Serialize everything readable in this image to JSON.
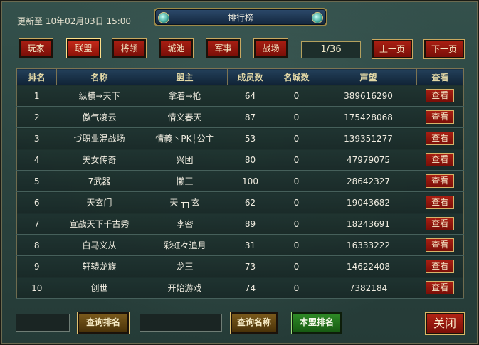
{
  "header": {
    "timestamp": "更新至 10年02月03日 15:00",
    "title": "排行榜"
  },
  "tabs": [
    {
      "label": "玩家",
      "active": false
    },
    {
      "label": "联盟",
      "active": true
    },
    {
      "label": "将领",
      "active": false
    },
    {
      "label": "城池",
      "active": false
    },
    {
      "label": "军事",
      "active": false
    },
    {
      "label": "战场",
      "active": false
    }
  ],
  "pagination": {
    "page_display": "1/36",
    "prev_label": "上一页",
    "next_label": "下一页"
  },
  "table": {
    "columns": [
      "排名",
      "名称",
      "盟主",
      "成员数",
      "名城数",
      "声望",
      "查看"
    ],
    "view_label": "查看",
    "rows": [
      {
        "rank": "1",
        "name": "纵横→天下",
        "leader": "拿着→枪",
        "members": "64",
        "cities": "0",
        "prestige": "389616290"
      },
      {
        "rank": "2",
        "name": "傲气凌云",
        "leader": "情义春天",
        "members": "87",
        "cities": "0",
        "prestige": "175428068"
      },
      {
        "rank": "3",
        "name": "づ职业混战场",
        "leader": "情義丶PK┆公主",
        "members": "53",
        "cities": "0",
        "prestige": "139351277"
      },
      {
        "rank": "4",
        "name": "美女传奇",
        "leader": "兴团",
        "members": "80",
        "cities": "0",
        "prestige": "47979075"
      },
      {
        "rank": "5",
        "name": "7武器",
        "leader": "懒王",
        "members": "100",
        "cities": "0",
        "prestige": "28642327"
      },
      {
        "rank": "6",
        "name": "天玄门",
        "leader": "天 ┳┓玄",
        "members": "62",
        "cities": "0",
        "prestige": "19043682"
      },
      {
        "rank": "7",
        "name": "宣战天下千古秀",
        "leader": "李密",
        "members": "89",
        "cities": "0",
        "prestige": "18243691"
      },
      {
        "rank": "8",
        "name": "白马义从",
        "leader": "彩虹々追月",
        "members": "31",
        "cities": "0",
        "prestige": "16333222"
      },
      {
        "rank": "9",
        "name": "轩辕龙族",
        "leader": "龙王",
        "members": "73",
        "cities": "0",
        "prestige": "14622408"
      },
      {
        "rank": "10",
        "name": "创世",
        "leader": "开始游戏",
        "members": "74",
        "cities": "0",
        "prestige": "7382184"
      }
    ]
  },
  "footer": {
    "rank_query_value": "",
    "query_rank_label": "查询排名",
    "name_query_value": "",
    "query_name_label": "查询名称",
    "my_rank_label": "本盟排名",
    "close_label": "关闭"
  },
  "colors": {
    "accent_red": "#a81e12",
    "gold_border": "#c9a860",
    "header_blue": "#102336",
    "green_button": "#2e8a26"
  }
}
